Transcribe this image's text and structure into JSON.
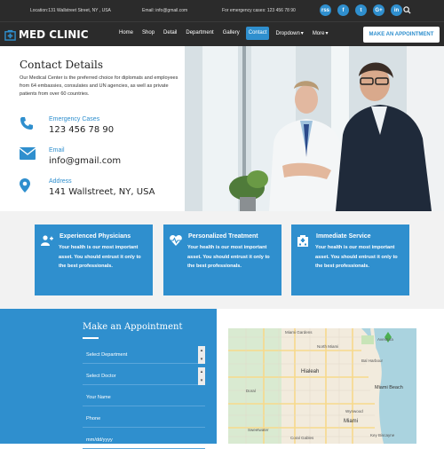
{
  "topbar": {
    "location": "Location:131 Wallstreet Street, NY , USA",
    "email": "Email: info@gmail.com",
    "emergency": "For emergency cases: 123 456 78 90",
    "social": [
      "rss",
      "f",
      "t",
      "G+",
      "in"
    ]
  },
  "navbar": {
    "logo": "MED CLINIC",
    "items": [
      "Home",
      "Shop",
      "Detail",
      "Department",
      "Gallery",
      "Contact",
      "Dropdown",
      "More"
    ],
    "active": "Contact",
    "cta": "MAKE AN APPOINTMENT"
  },
  "contact": {
    "title": "Contact Details",
    "description": "Our Medical Center is the preferred choice for diplomats and employees from 64 embassies, consulates and UN agencies, as well as private patients from over 60 countries.",
    "items": [
      {
        "label": "Emergency Cases",
        "value": "123 456 78 90",
        "icon": "phone-icon"
      },
      {
        "label": "Email",
        "value": "info@gmail.com",
        "icon": "envelope-icon"
      },
      {
        "label": "Address",
        "value": "141 Wallstreet, NY, USA",
        "icon": "location-pin-icon"
      }
    ]
  },
  "features": [
    {
      "title": "Experienced Physicians",
      "text": "Your health is our most important asset. You should entrust it only to the best professionals.",
      "icon": "user-plus-icon"
    },
    {
      "title": "Personalized Treatment",
      "text": "Your health is our most important asset. You should entrust it only to the best professionals.",
      "icon": "heartbeat-icon"
    },
    {
      "title": "Immediate Service",
      "text": "Your health is our most important asset. You should entrust it only to the best professionals.",
      "icon": "hospital-icon"
    }
  ],
  "appointment": {
    "title": "Make an Appointment",
    "department": "Select Department",
    "doctor": "Select Doctor",
    "name": "Your Name",
    "phone": "Phone",
    "date": "mm/dd/yyyy"
  },
  "map": {
    "labels": [
      "Hialeah",
      "Miami",
      "Miami Beach",
      "Miami Gardens",
      "North Miami",
      "Doral",
      "Sweetwater",
      "Key Biscayne",
      "Coral Gables",
      "Bal Harbour",
      "Aventura",
      "Wynwood"
    ]
  },
  "colors": {
    "accent": "#2f8fce",
    "dark": "#2b2b2b"
  }
}
